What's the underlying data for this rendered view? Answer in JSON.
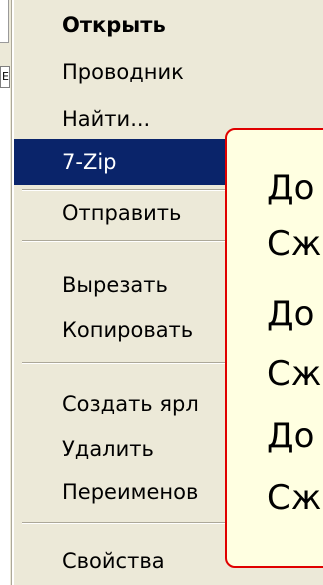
{
  "background_window": {
    "edge_letter": "E"
  },
  "context_menu": {
    "items": [
      {
        "label": "Открыть"
      },
      {
        "label": "Проводник"
      },
      {
        "label": "Найти..."
      },
      {
        "label": "7-Zip"
      },
      {
        "label": "Отправить"
      },
      {
        "label": "Вырезать"
      },
      {
        "label": "Копировать"
      },
      {
        "label": "Создать ярл"
      },
      {
        "label": "Удалить"
      },
      {
        "label": "Переименов"
      },
      {
        "label": "Свойства"
      }
    ]
  },
  "submenu": {
    "items": [
      {
        "label": "До"
      },
      {
        "label": "Сж"
      },
      {
        "label": "До"
      },
      {
        "label": "Сж"
      },
      {
        "label": "До"
      },
      {
        "label": "Сж"
      }
    ]
  },
  "colors": {
    "menu_bg": "#ece9d8",
    "selection_bg": "#0a246a",
    "submenu_bg": "#ffffe1",
    "submenu_border": "#e00000"
  }
}
